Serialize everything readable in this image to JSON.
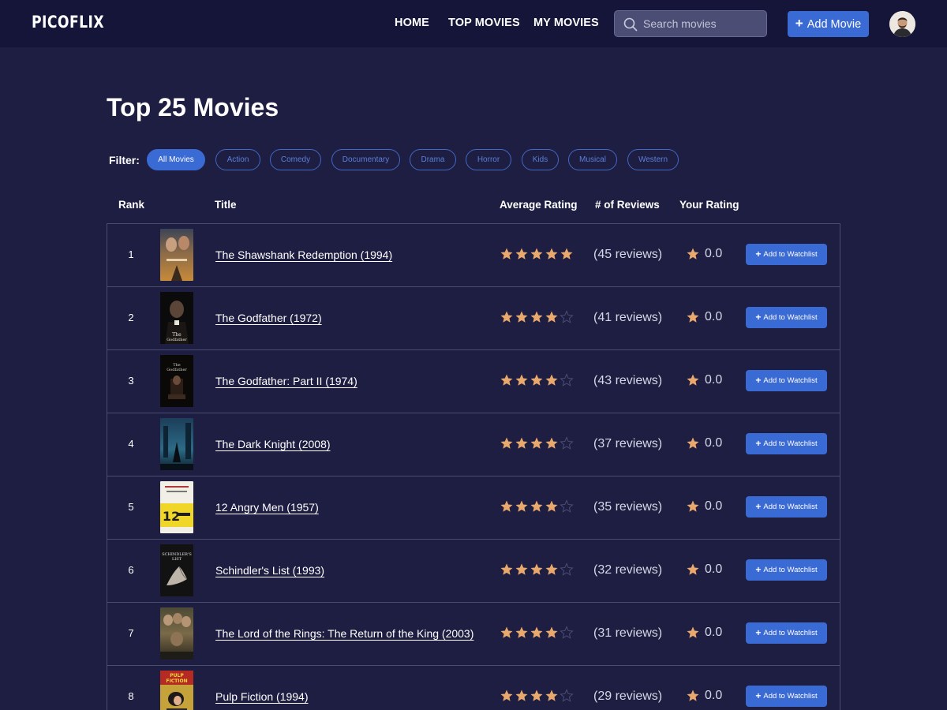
{
  "header": {
    "logo": "PICOFLIX",
    "nav": [
      {
        "label": "HOME"
      },
      {
        "label": "TOP MOVIES"
      },
      {
        "label": "MY MOVIES"
      }
    ],
    "search_placeholder": "Search movies",
    "add_movie_label": "Add Movie",
    "add_movie_icon": "plus-icon"
  },
  "page": {
    "title": "Top 25 Movies",
    "filter_label": "Filter:",
    "filters": [
      {
        "label": "All Movies",
        "active": true
      },
      {
        "label": "Action"
      },
      {
        "label": "Comedy"
      },
      {
        "label": "Documentary"
      },
      {
        "label": "Drama"
      },
      {
        "label": "Horror"
      },
      {
        "label": "Kids"
      },
      {
        "label": "Musical"
      },
      {
        "label": "Western"
      }
    ]
  },
  "table": {
    "columns": {
      "rank": "Rank",
      "title": "Title",
      "avg_rating": "Average Rating",
      "reviews": "# of Reviews",
      "your_rating": "Your Rating"
    },
    "watchlist_label": "Add to Watchlist",
    "rows": [
      {
        "rank": "1",
        "title": "The Shawshank Redemption (1994)",
        "stars": 5,
        "reviews": "(45 reviews)",
        "your_rating": "0.0"
      },
      {
        "rank": "2",
        "title": "The Godfather (1972)",
        "stars": 4,
        "reviews": "(41 reviews)",
        "your_rating": "0.0"
      },
      {
        "rank": "3",
        "title": "The Godfather: Part II (1974)",
        "stars": 4,
        "reviews": "(43 reviews)",
        "your_rating": "0.0"
      },
      {
        "rank": "4",
        "title": "The Dark Knight (2008)",
        "stars": 4,
        "reviews": "(37 reviews)",
        "your_rating": "0.0"
      },
      {
        "rank": "5",
        "title": "12 Angry Men (1957)",
        "stars": 4,
        "reviews": "(35 reviews)",
        "your_rating": "0.0"
      },
      {
        "rank": "6",
        "title": "Schindler's List (1993)",
        "stars": 4,
        "reviews": "(32 reviews)",
        "your_rating": "0.0"
      },
      {
        "rank": "7",
        "title": "The Lord of the Rings: The Return of the King (2003)",
        "stars": 4,
        "reviews": "(31 reviews)",
        "your_rating": "0.0"
      },
      {
        "rank": "8",
        "title": "Pulp Fiction (1994)",
        "stars": 4,
        "reviews": "(29 reviews)",
        "your_rating": "0.0"
      }
    ]
  },
  "colors": {
    "background": "#1e1e42",
    "header": "#141538",
    "accent": "#3a6ad4",
    "star": "#e9a86c"
  }
}
